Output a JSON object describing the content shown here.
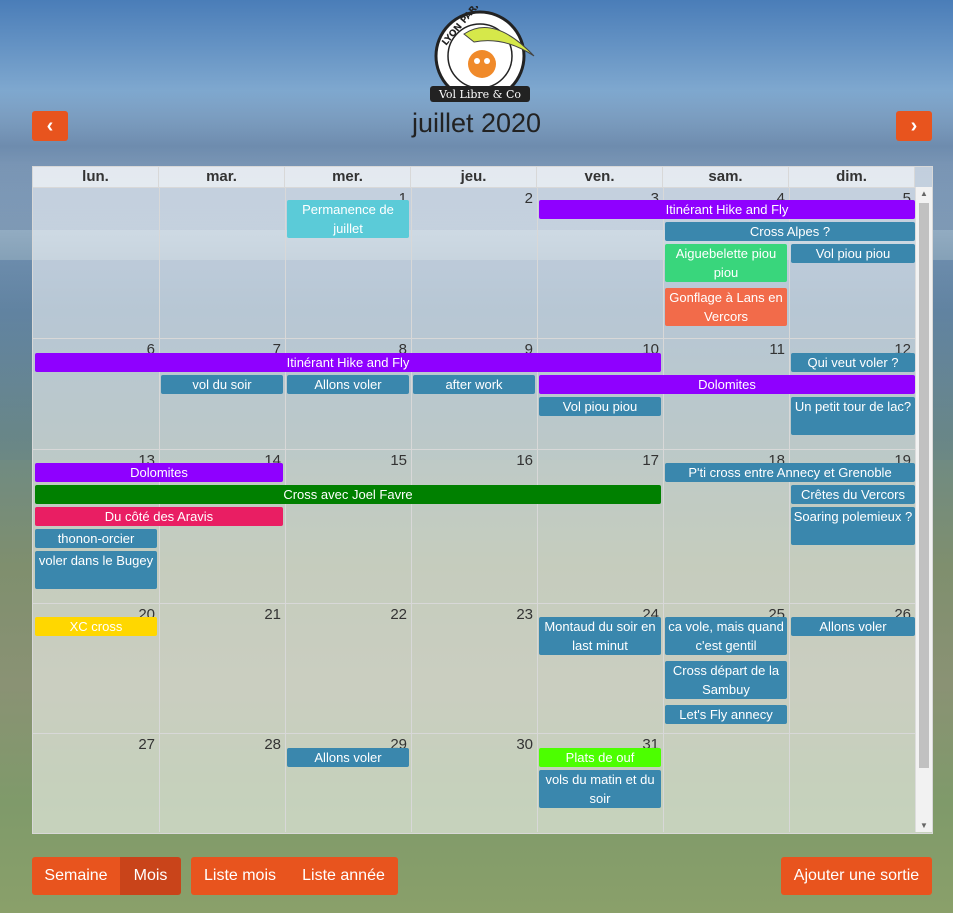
{
  "logo": {
    "top_text": "LYON PARAPENTE",
    "bottom_text": "Vol Libre & Co"
  },
  "nav": {
    "prev_icon": "chevron-left-icon",
    "next_icon": "chevron-right-icon",
    "prev": "‹",
    "next": "›"
  },
  "title": "juillet 2020",
  "weekdays": [
    "lun.",
    "mar.",
    "mer.",
    "jeu.",
    "ven.",
    "sam.",
    "dim."
  ],
  "days": [
    [
      "",
      "",
      "1",
      "2",
      "3",
      "4",
      "5"
    ],
    [
      "6",
      "7",
      "8",
      "9",
      "10",
      "11",
      "12"
    ],
    [
      "13",
      "14",
      "15",
      "16",
      "17",
      "18",
      "19"
    ],
    [
      "20",
      "21",
      "22",
      "23",
      "24",
      "25",
      "26"
    ],
    [
      "27",
      "28",
      "29",
      "30",
      "31",
      "",
      ""
    ]
  ],
  "events": [
    {
      "w": 0,
      "s": 2,
      "e": 2,
      "l": 0,
      "rows": 2,
      "text": "Permanence de juillet",
      "color": "#5bcbd8"
    },
    {
      "w": 0,
      "s": 4,
      "e": 6,
      "l": 0,
      "rows": 1,
      "text": "Itinérant Hike and Fly",
      "color": "#8f00ff"
    },
    {
      "w": 0,
      "s": 5,
      "e": 6,
      "l": 1,
      "rows": 1,
      "text": "Cross Alpes ?",
      "color": "#3a87ad"
    },
    {
      "w": 0,
      "s": 5,
      "e": 5,
      "l": 2,
      "rows": 2,
      "text": "Aiguebelette piou piou",
      "color": "#39d67c"
    },
    {
      "w": 0,
      "s": 6,
      "e": 6,
      "l": 2,
      "rows": 1,
      "text": "Vol piou piou",
      "color": "#3a87ad"
    },
    {
      "w": 0,
      "s": 5,
      "e": 5,
      "l": 4,
      "rows": 2,
      "text": "Gonflage à Lans en Vercors",
      "color": "#f26b4a"
    },
    {
      "w": 1,
      "s": 0,
      "e": 4,
      "l": 0,
      "rows": 1,
      "text": "Itinérant Hike and Fly",
      "color": "#8f00ff"
    },
    {
      "w": 1,
      "s": 6,
      "e": 6,
      "l": 0,
      "rows": 1,
      "text": "Qui veut voler ?",
      "color": "#3a87ad"
    },
    {
      "w": 1,
      "s": 1,
      "e": 1,
      "l": 1,
      "rows": 1,
      "text": "vol du soir",
      "color": "#3a87ad"
    },
    {
      "w": 1,
      "s": 2,
      "e": 2,
      "l": 1,
      "rows": 1,
      "text": "Allons voler",
      "color": "#3a87ad"
    },
    {
      "w": 1,
      "s": 3,
      "e": 3,
      "l": 1,
      "rows": 1,
      "text": "after work",
      "color": "#3a87ad"
    },
    {
      "w": 1,
      "s": 4,
      "e": 6,
      "l": 1,
      "rows": 1,
      "text": "Dolomites",
      "color": "#8f00ff"
    },
    {
      "w": 1,
      "s": 4,
      "e": 4,
      "l": 2,
      "rows": 1,
      "text": "Vol piou piou",
      "color": "#3a87ad"
    },
    {
      "w": 1,
      "s": 6,
      "e": 6,
      "l": 2,
      "rows": 2,
      "text": "Un petit tour de lac?",
      "color": "#3a87ad"
    },
    {
      "w": 2,
      "s": 0,
      "e": 1,
      "l": 0,
      "rows": 1,
      "text": "Dolomites",
      "color": "#8f00ff"
    },
    {
      "w": 2,
      "s": 5,
      "e": 6,
      "l": 0,
      "rows": 1,
      "text": "P'ti cross entre Annecy et Grenoble",
      "color": "#3a87ad"
    },
    {
      "w": 2,
      "s": 0,
      "e": 4,
      "l": 1,
      "rows": 1,
      "text": "Cross avec Joel Favre",
      "color": "#008000"
    },
    {
      "w": 2,
      "s": 6,
      "e": 6,
      "l": 1,
      "rows": 1,
      "text": "Crêtes du Vercors",
      "color": "#3a87ad"
    },
    {
      "w": 2,
      "s": 0,
      "e": 1,
      "l": 2,
      "rows": 1,
      "text": "Du côté des Aravis",
      "color": "#e91e63"
    },
    {
      "w": 2,
      "s": 6,
      "e": 6,
      "l": 2,
      "rows": 2,
      "text": "Soaring polemieux ?",
      "color": "#3a87ad"
    },
    {
      "w": 2,
      "s": 0,
      "e": 0,
      "l": 3,
      "rows": 1,
      "text": "thonon-orcier",
      "color": "#3a87ad"
    },
    {
      "w": 2,
      "s": 0,
      "e": 0,
      "l": 4,
      "rows": 2,
      "text": "voler dans le Bugey",
      "color": "#3a87ad"
    },
    {
      "w": 3,
      "s": 0,
      "e": 0,
      "l": 0,
      "rows": 1,
      "text": "XC cross",
      "color": "#ffd700"
    },
    {
      "w": 3,
      "s": 4,
      "e": 4,
      "l": 0,
      "rows": 2,
      "text": "Montaud du soir en last minut",
      "color": "#3a87ad"
    },
    {
      "w": 3,
      "s": 5,
      "e": 5,
      "l": 0,
      "rows": 2,
      "text": "ca vole, mais quand c'est gentil",
      "color": "#3a87ad"
    },
    {
      "w": 3,
      "s": 6,
      "e": 6,
      "l": 0,
      "rows": 1,
      "text": "Allons voler",
      "color": "#3a87ad"
    },
    {
      "w": 3,
      "s": 5,
      "e": 5,
      "l": 2,
      "rows": 2,
      "text": "Cross départ de la Sambuy",
      "color": "#3a87ad"
    },
    {
      "w": 3,
      "s": 5,
      "e": 5,
      "l": 4,
      "rows": 1,
      "text": "Let's Fly annecy",
      "color": "#3a87ad"
    },
    {
      "w": 4,
      "s": 2,
      "e": 2,
      "l": 0,
      "rows": 1,
      "text": "Allons voler",
      "color": "#3a87ad"
    },
    {
      "w": 4,
      "s": 4,
      "e": 4,
      "l": 0,
      "rows": 1,
      "text": "Plats de ouf",
      "color": "#4cff00"
    },
    {
      "w": 4,
      "s": 4,
      "e": 4,
      "l": 1,
      "rows": 2,
      "text": "vols du matin et du soir",
      "color": "#3a87ad"
    }
  ],
  "buttons": {
    "week": "Semaine",
    "month": "Mois",
    "list_month": "Liste mois",
    "list_year": "Liste année",
    "add": "Ajouter une sortie"
  }
}
